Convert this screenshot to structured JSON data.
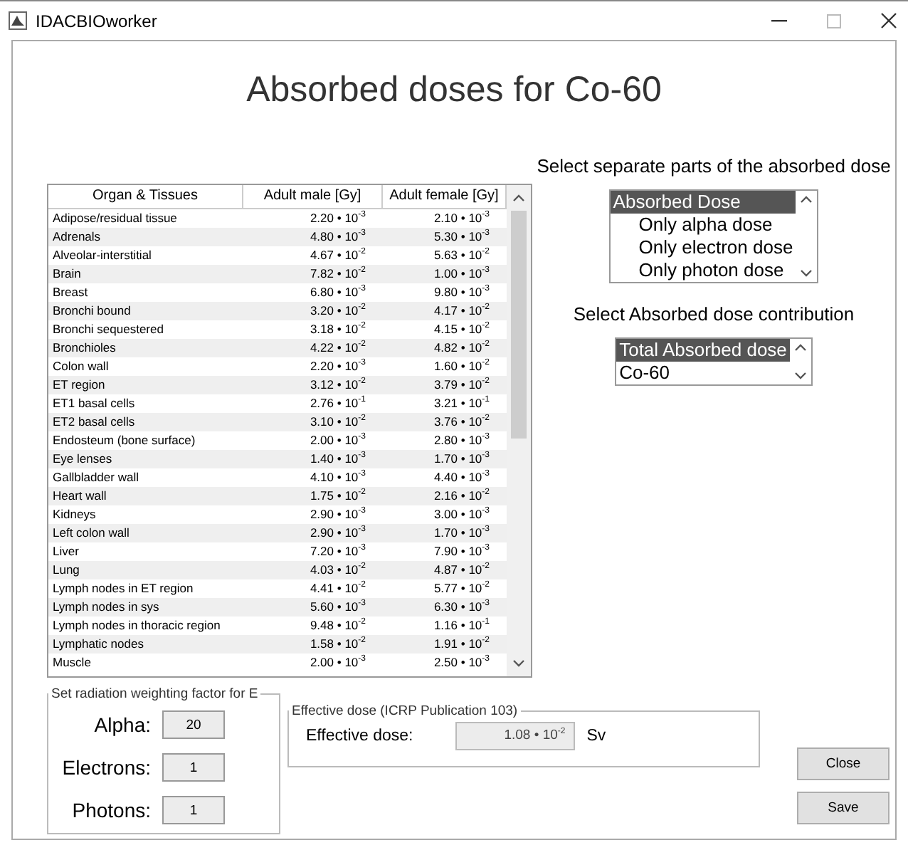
{
  "window": {
    "title": "IDACBIOworker"
  },
  "heading": "Absorbed doses for Co-60",
  "table": {
    "columns": [
      "Organ & Tissues",
      "Adult male [Gy]",
      "Adult female [Gy]"
    ],
    "rows": [
      {
        "organ": "Adipose/residual tissue",
        "male": "2.20 • 10$^{-3}$",
        "female": "2.10 • 10$^{-3}$"
      },
      {
        "organ": "Adrenals",
        "male": "4.80 • 10$^{-3}$",
        "female": "5.30 • 10$^{-3}$"
      },
      {
        "organ": "Alveolar-interstitial",
        "male": "4.67 • 10$^{-2}$",
        "female": "5.63 • 10$^{-2}$"
      },
      {
        "organ": "Brain",
        "male": "7.82 • 10$^{-2}$",
        "female": "1.00 • 10$^{-3}$"
      },
      {
        "organ": "Breast",
        "male": "6.80 • 10$^{-3}$",
        "female": "9.80 • 10$^{-3}$"
      },
      {
        "organ": "Bronchi bound",
        "male": "3.20 • 10$^{-2}$",
        "female": "4.17 • 10$^{-2}$"
      },
      {
        "organ": "Bronchi sequestered",
        "male": "3.18 • 10$^{-2}$",
        "female": "4.15 • 10$^{-2}$"
      },
      {
        "organ": "Bronchioles",
        "male": "4.22 • 10$^{-2}$",
        "female": "4.82 • 10$^{-2}$"
      },
      {
        "organ": "Colon wall",
        "male": "2.20 • 10$^{-3}$",
        "female": "1.60 • 10$^{-2}$"
      },
      {
        "organ": "ET region",
        "male": "3.12 • 10$^{-2}$",
        "female": "3.79 • 10$^{-2}$"
      },
      {
        "organ": "ET1 basal cells",
        "male": "2.76 • 10$^{-1}$",
        "female": "3.21 • 10$^{-1}$"
      },
      {
        "organ": "ET2 basal cells",
        "male": "3.10 • 10$^{-2}$",
        "female": "3.76 • 10$^{-2}$"
      },
      {
        "organ": "Endosteum (bone surface)",
        "male": "2.00 • 10$^{-3}$",
        "female": "2.80 • 10$^{-3}$"
      },
      {
        "organ": "Eye lenses",
        "male": "1.40 • 10$^{-3}$",
        "female": "1.70 • 10$^{-3}$"
      },
      {
        "organ": "Gallbladder wall",
        "male": "4.10 • 10$^{-3}$",
        "female": "4.40 • 10$^{-3}$"
      },
      {
        "organ": "Heart wall",
        "male": "1.75 • 10$^{-2}$",
        "female": "2.16 • 10$^{-2}$"
      },
      {
        "organ": "Kidneys",
        "male": "2.90 • 10$^{-3}$",
        "female": "3.00 • 10$^{-3}$"
      },
      {
        "organ": "Left colon wall",
        "male": "2.90 • 10$^{-3}$",
        "female": "1.70 • 10$^{-3}$"
      },
      {
        "organ": "Liver",
        "male": "7.20 • 10$^{-3}$",
        "female": "7.90 • 10$^{-3}$"
      },
      {
        "organ": "Lung",
        "male": "4.03 • 10$^{-2}$",
        "female": "4.87 • 10$^{-2}$"
      },
      {
        "organ": "Lymph nodes in ET region",
        "male": "4.41 • 10$^{-2}$",
        "female": "5.77 • 10$^{-2}$"
      },
      {
        "organ": "Lymph nodes in sys",
        "male": "5.60 • 10$^{-3}$",
        "female": "6.30 • 10$^{-3}$"
      },
      {
        "organ": "Lymph nodes in thoracic region",
        "male": "9.48 • 10$^{-2}$",
        "female": "1.16 • 10$^{-1}$"
      },
      {
        "organ": "Lymphatic nodes",
        "male": "1.58 • 10$^{-2}$",
        "female": "1.91 • 10$^{-2}$"
      },
      {
        "organ": "Muscle",
        "male": "2.00 • 10$^{-3}$",
        "female": "2.50 • 10$^{-3}$"
      }
    ]
  },
  "dose_parts": {
    "label": "Select separate parts of the absorbed dose",
    "items": [
      {
        "label": "Absorbed Dose",
        "selected": true,
        "children": [
          {
            "label": "Only alpha dose",
            "selected": false
          },
          {
            "label": "Only electron dose",
            "selected": false
          },
          {
            "label": "Only photon dose",
            "selected": false
          }
        ]
      }
    ]
  },
  "contribution": {
    "label": "Select Absorbed dose contribution",
    "items": [
      {
        "label": "Total Absorbed dose",
        "selected": true
      },
      {
        "label": "Co-60",
        "selected": false
      }
    ]
  },
  "weighting": {
    "legend": "Set radiation weighting factor for E",
    "factors": [
      {
        "label": "Alpha:",
        "value": "20"
      },
      {
        "label": "Electrons:",
        "value": "1"
      },
      {
        "label": "Photons:",
        "value": "1"
      }
    ]
  },
  "effective": {
    "legend": "Effective dose (ICRP Publication 103)",
    "label": "Effective dose:",
    "value": "1.08 • 10$^{-2}$",
    "unit": "Sv"
  },
  "buttons": [
    "Close",
    "Save"
  ]
}
